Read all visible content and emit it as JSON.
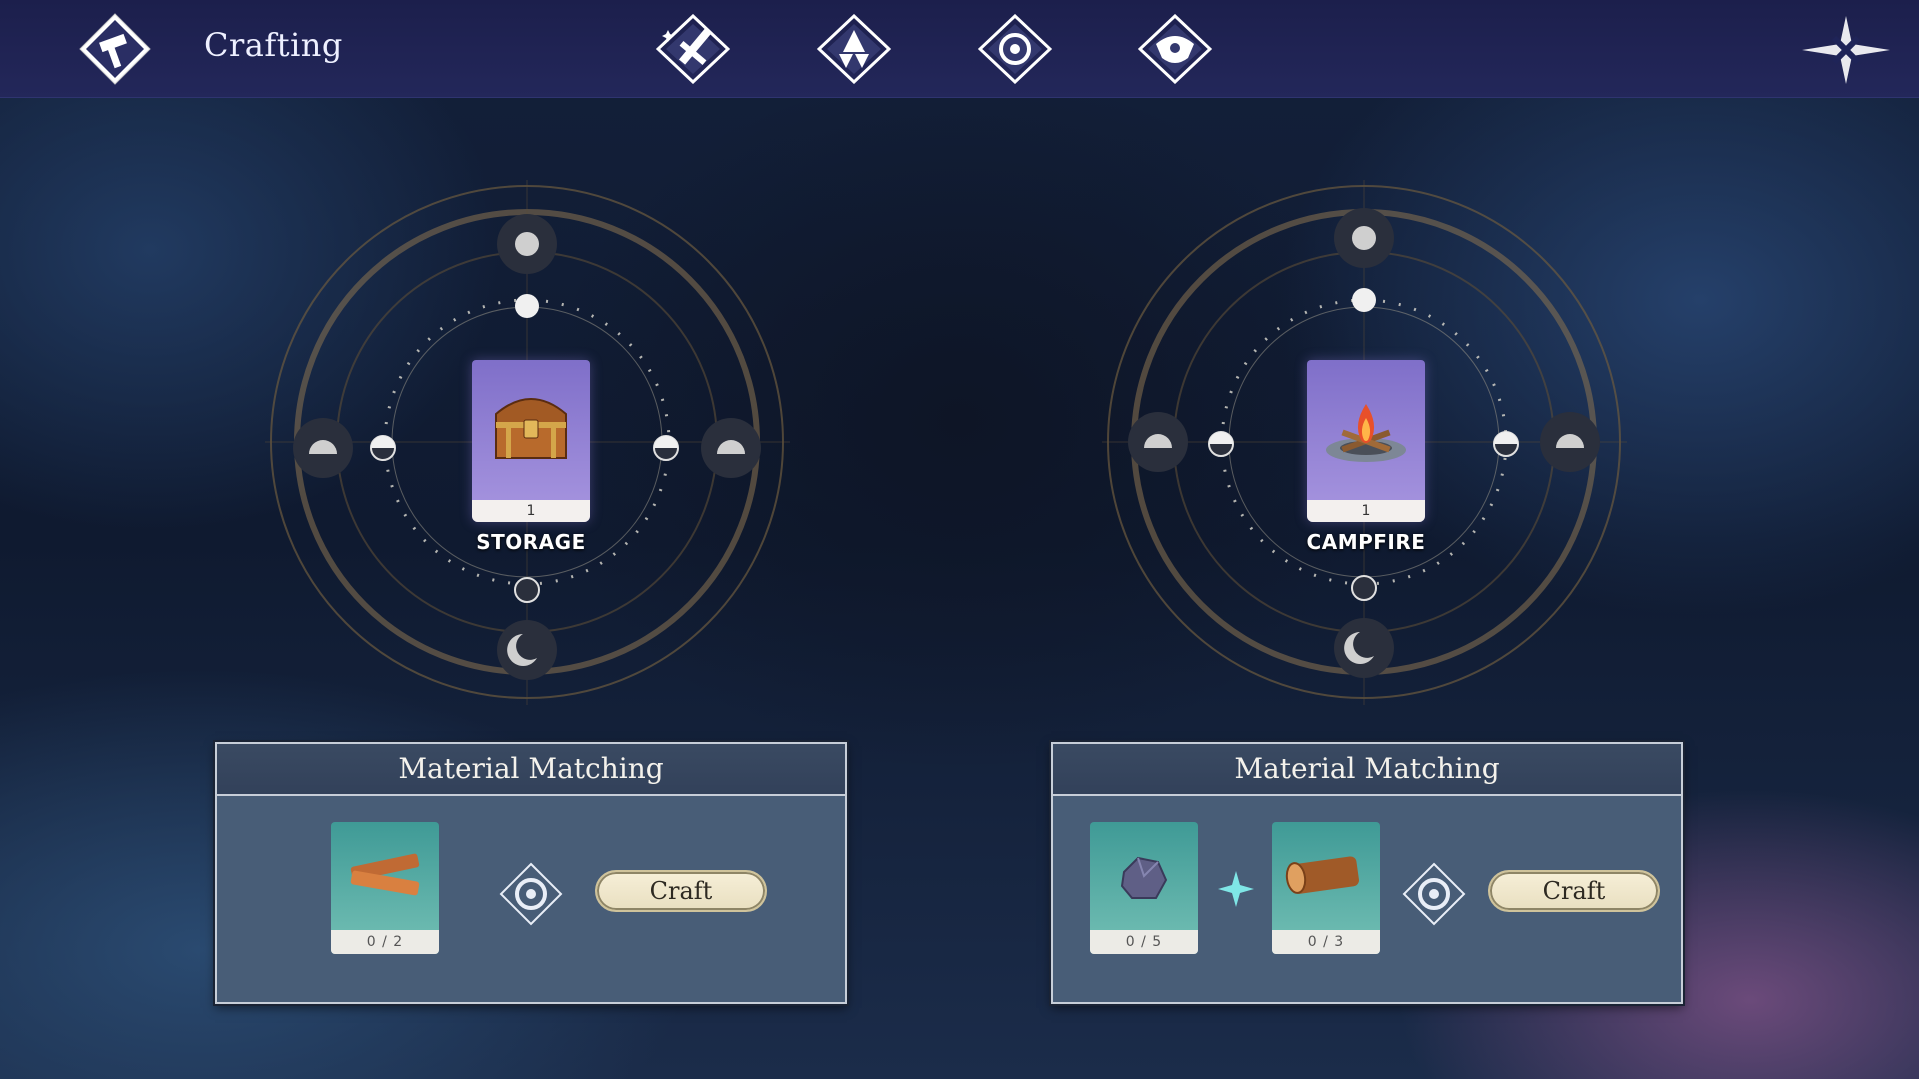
{
  "header": {
    "title": "Crafting",
    "logo_icon": "hammer-diamond-icon",
    "tabs": [
      {
        "icon": "sword-tab-icon"
      },
      {
        "icon": "triad-tab-icon"
      },
      {
        "icon": "ring-tab-icon"
      },
      {
        "icon": "crest-tab-icon"
      }
    ],
    "close_icon": "close-star-icon"
  },
  "recipes": [
    {
      "name": "STORAGE",
      "quantity": "1",
      "item_icon": "treasure-chest-icon",
      "panel_title": "Material Matching",
      "materials": [
        {
          "icon": "wood-planks-icon",
          "count": "0 / 2"
        }
      ],
      "craft_label": "Craft"
    },
    {
      "name": "CAMPFIRE",
      "quantity": "1",
      "item_icon": "campfire-icon",
      "panel_title": "Material Matching",
      "materials": [
        {
          "icon": "stone-icon",
          "count": "0 / 5"
        },
        {
          "icon": "log-icon",
          "count": "0 / 3"
        }
      ],
      "craft_label": "Craft"
    }
  ],
  "colors": {
    "topbar": "#23275a",
    "card": "#a896e0",
    "slot": "#74c0b5",
    "panel": "#485d77",
    "craft_button": "#f1e8cd",
    "plus_accent": "#7fe6e6"
  }
}
